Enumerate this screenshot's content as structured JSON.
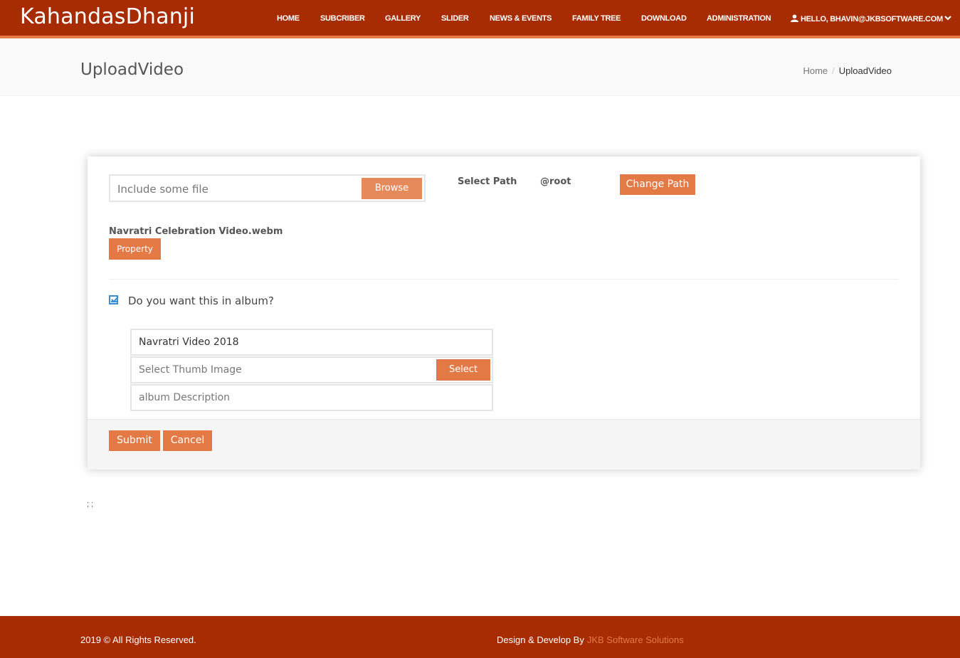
{
  "brand": "KahandasDhanji",
  "nav": {
    "items": [
      "HOME",
      "SUBCRIBER",
      "GALLERY",
      "SLIDER",
      "NEWS & EVENTS",
      "FAMILY TREE",
      "DOWNLOAD",
      "ADMINISTRATION"
    ],
    "user": "HELLO, BHAVIN@JKBSOFTWARE.COM"
  },
  "page": {
    "title": "UploadVideo",
    "breadcrumb": {
      "home": "Home",
      "separator": "/",
      "current": "UploadVideo"
    }
  },
  "upload": {
    "file_placeholder": "Include some file",
    "browse_label": "Browse",
    "select_path_label": "Select Path",
    "path_value": "@root",
    "change_path_label": "Change Path",
    "file_name": "Navratri Celebration Video.webm",
    "property_label": "Property"
  },
  "album": {
    "checkbox_checked": true,
    "checkbox_label": "Do you want this in album?",
    "name_value": "Navratri  Video 2018",
    "thumb_placeholder": "Select Thumb Image",
    "select_label": "Select",
    "description_placeholder": "album Description"
  },
  "actions": {
    "submit_label": "Submit",
    "cancel_label": "Cancel"
  },
  "stray_text": "; ;",
  "footer": {
    "copyright": "2019 © All Rights Reserved.",
    "credits_prefix": "Design & Develop By",
    "credits_link": "JKB Software Solutions"
  },
  "colors": {
    "primary": "#a72c04",
    "accent": "#e37a45",
    "checkbox": "#3a8fd0"
  },
  "icons": {
    "user": "user-icon",
    "chevron": "chevron-down-icon",
    "check": "check-icon"
  }
}
